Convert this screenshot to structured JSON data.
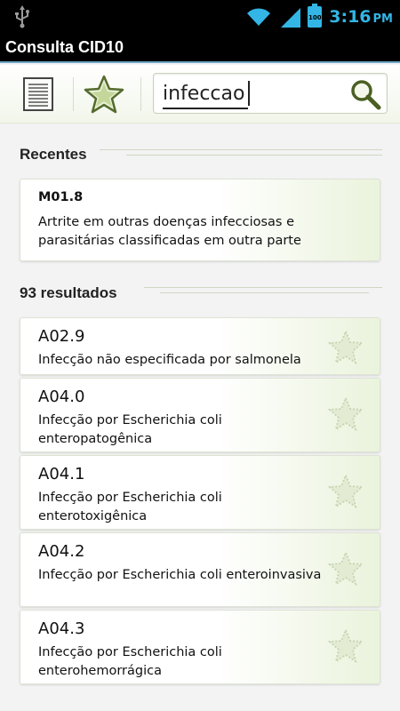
{
  "status_bar": {
    "time": "3:16",
    "ampm": "PM",
    "battery_level": "100",
    "icons": [
      "usb-icon",
      "wifi-icon",
      "signal-icon",
      "battery-icon"
    ]
  },
  "app": {
    "title": "Consulta CID10"
  },
  "toolbar": {
    "list_icon": "list-icon",
    "favorites_icon": "star-icon",
    "search_value": "infeccao",
    "search_icon": "search-icon"
  },
  "recent": {
    "header": "Recentes",
    "item": {
      "code": "M01.8",
      "description": "Artrite em outras doenças infecciosas e parasitárias classificadas em outra parte"
    }
  },
  "results": {
    "header": "93 resultados",
    "items": [
      {
        "code": "A02.9",
        "description": "Infecção não especificada por salmonela"
      },
      {
        "code": "A04.0",
        "description": "Infecção por Escherichia coli enteropatogênica"
      },
      {
        "code": "A04.1",
        "description": "Infecção por Escherichia coli enterotoxigênica"
      },
      {
        "code": "A04.2",
        "description": "Infecção por Escherichia coli enteroinvasiva"
      },
      {
        "code": "A04.3",
        "description": "Infecção por Escherichia coli enterohemorrágica"
      }
    ]
  },
  "colors": {
    "status_accent": "#33b5e5",
    "card_gradient_end": "#eaf3dc",
    "star_green": "#7a9a3a"
  }
}
